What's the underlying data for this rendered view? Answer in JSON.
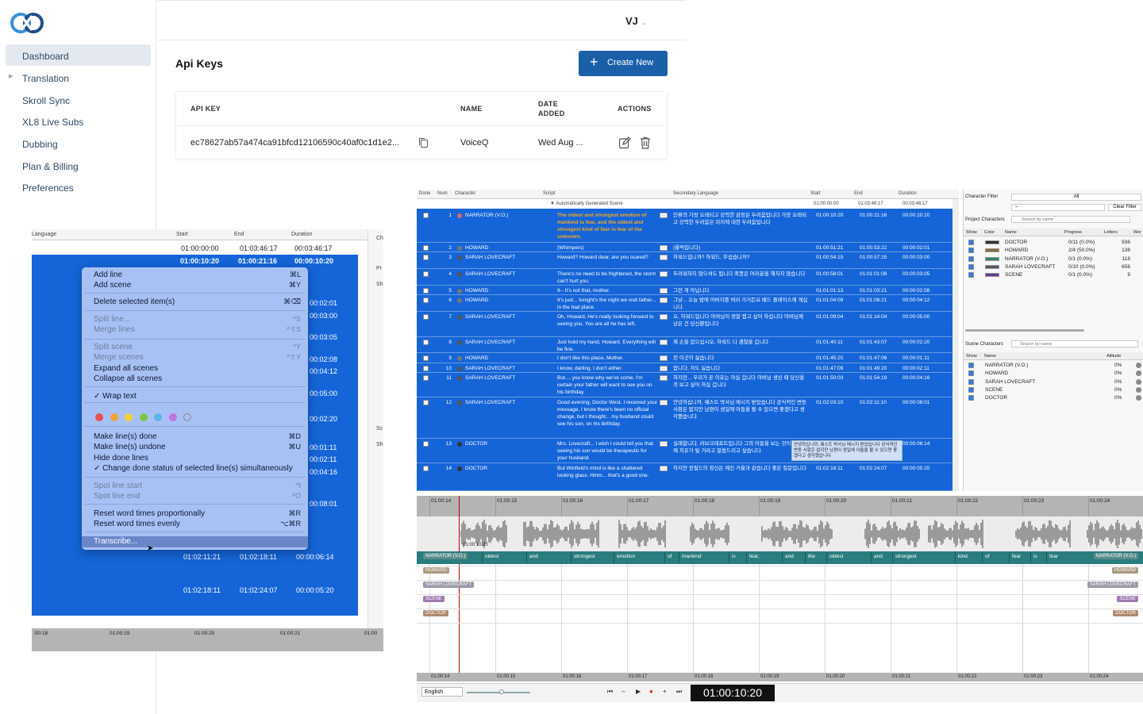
{
  "sidebar": {
    "items": [
      {
        "label": "Dashboard"
      },
      {
        "label": "Translation"
      },
      {
        "label": "Skroll Sync"
      },
      {
        "label": "XL8 Live Subs"
      },
      {
        "label": "Dubbing"
      },
      {
        "label": "Plan & Billing"
      },
      {
        "label": "Preferences"
      }
    ]
  },
  "header": {
    "user_initials": "VJ",
    "user_caret": "⌄"
  },
  "page": {
    "title": "Api Keys",
    "create_button": "Create New",
    "table": {
      "columns": [
        "API KEY",
        "NAME",
        "DATE",
        "ADDED",
        "ACTIONS"
      ],
      "rows": [
        {
          "api_key": "ec78627ab57a474ca91bfcd12106590c40af0c1d1e2...",
          "name": "VoiceQ",
          "date": "Wed Aug ..."
        }
      ]
    }
  },
  "editor_left": {
    "headers": [
      "Language",
      "Start",
      "End",
      "Duration",
      "Ch",
      "Pr",
      "Sh",
      "Sc",
      "Sh"
    ],
    "top_row": [
      "01:00:00:00",
      "01:03:46:17",
      "00:03:46:17"
    ],
    "sel_row": [
      "01:00:10:20",
      "01:00:21:16",
      "00:00:10:20"
    ],
    "durations": [
      "00:02:01",
      "00:03:00",
      "00:03:05",
      "00:02:08",
      "00:04:12",
      "00:05:00",
      "00:02:20",
      "00:01:11",
      "00:02:11",
      "00:04:16",
      "00:08:01"
    ],
    "bottom_rows": [
      [
        "01:02:11:21",
        "01:02:18:11",
        "00:00:06:14"
      ],
      [
        "01:02:18:11",
        "01:02:24:07",
        "00:00:05:20"
      ]
    ],
    "ruler": [
      ":00:18",
      "01:00:19",
      "01:00:20",
      "01:00:21",
      "01:00"
    ],
    "menu": {
      "items": [
        {
          "label": "Add line",
          "shortcut": "⌘L"
        },
        {
          "label": "Add scene",
          "shortcut": "⌘Y"
        },
        {
          "label": "Delete selected item(s)",
          "shortcut": "⌘⌫"
        },
        {
          "label": "Split line...",
          "shortcut": "^S"
        },
        {
          "label": "Merge lines",
          "shortcut": "^⇧S"
        },
        {
          "label": "Split scene",
          "shortcut": "^Y"
        },
        {
          "label": "Merge scenes",
          "shortcut": "^⇧Y"
        },
        {
          "label": "Expand all scenes",
          "shortcut": ""
        },
        {
          "label": "Collapse all scenes",
          "shortcut": ""
        },
        {
          "label": "✓ Wrap text",
          "shortcut": ""
        },
        {
          "label": "Make line(s) done",
          "shortcut": "⌘D"
        },
        {
          "label": "Make line(s) undone",
          "shortcut": "⌘U"
        },
        {
          "label": "Hide done lines",
          "shortcut": ""
        },
        {
          "label": "✓ Change done status of selected line(s) simultaneously",
          "shortcut": ""
        },
        {
          "label": "Spot line start",
          "shortcut": "^I"
        },
        {
          "label": "Spot line end",
          "shortcut": "^O"
        },
        {
          "label": "Reset word times proportionally",
          "shortcut": "⌘R"
        },
        {
          "label": "Reset word times evenly",
          "shortcut": "⌥⌘R"
        },
        {
          "label": "Transcribe...",
          "shortcut": ""
        }
      ],
      "colors": [
        "#e85151",
        "#f2a13c",
        "#f2d23c",
        "#7bc943",
        "#5ab6e8",
        "#c173e0"
      ]
    }
  },
  "editor_right": {
    "headers": [
      "Done",
      "Num",
      "Character",
      "Script",
      "Secondary Language",
      "Start",
      "End",
      "Duration"
    ],
    "scene_label": "▼ Automatically Generated Scene",
    "scene_times": [
      "01:00:00:00",
      "01:03:46:17",
      "00:03:46:17"
    ],
    "rows": [
      {
        "num": "1",
        "char": "NARRATOR (V.O.)",
        "script": "The oldest and strongest emotion of mankind is fear, and the oldest and strongest kind of fear is fear of the unknown.",
        "sec": "인류의 가장 오래되고 강력한 감정은 두려움입니다 가장 오래되고 강력한 두려움은 미지에 대한 두려움입니다",
        "start": "01:00:10:20",
        "end": "01:00:21:16",
        "dur": "00:00:10:20"
      },
      {
        "num": "2",
        "char": "HOWARD",
        "script": "(Whimpers)",
        "sec": "(울먹입니다)",
        "start": "01:00:51:21",
        "end": "01:00:53:22",
        "dur": "00:00:02:01"
      },
      {
        "num": "3",
        "char": "SARAH LOVECRAFT",
        "script": "Howard? Howard dear, are you scared?",
        "sec": "하워드입니까? 하워드, 무섭습니까?",
        "start": "01:00:54:15",
        "end": "01:00:57:15",
        "dur": "00:00:03:00"
      },
      {
        "num": "4",
        "char": "SARAH LOVECRAFT",
        "script": "There's no need to be frightened, the storm can't hurt you.",
        "sec": "두려워하지 않으셔도 됩니다 폭풍은 여러분을 해치지 않습니다",
        "start": "01:00:58:01",
        "end": "01:01:01:06",
        "dur": "00:00:03:05"
      },
      {
        "num": "5",
        "char": "HOWARD",
        "script": "It-- It's not that, mother.",
        "sec": "그런 게 아닙니다",
        "start": "01:01:01:13",
        "end": "01:01:03:21",
        "dur": "00:00:02:08"
      },
      {
        "num": "6",
        "char": "HOWARD",
        "script": "It's just... tonight's the night we visit father... in the bad place.",
        "sec": "그냥... 오늘 밤에 아버지를 뵈러 가거든요 배드 플레이스에 계십니다",
        "start": "01:01:04:09",
        "end": "01:01:08:21",
        "dur": "00:00:04:12"
      },
      {
        "num": "7",
        "char": "SARAH LOVECRAFT",
        "script": "Oh, Howard. He's really looking forward to seeing you. You are all he has left.",
        "sec": "오, 하워드입니다 아버님이 정말 뵙고 싶어 하십니다 아버님께 남은 건 당신뿐입니다",
        "start": "01:01:09:04",
        "end": "01:01:14:04",
        "dur": "00:00:05:00"
      },
      {
        "num": "8",
        "char": "SARAH LOVECRAFT",
        "script": "Just hold my hand, Howard. Everything will be fine.",
        "sec": "제 손을 잡으십시오, 하워드 다 괜찮을 겁니다",
        "start": "01:01:40:11",
        "end": "01:01:43:07",
        "dur": "00:00:02:20"
      },
      {
        "num": "9",
        "char": "HOWARD",
        "script": "I don't like this place, Mother.",
        "sec": "전 이곳이 싫습니다",
        "start": "01:01:45:20",
        "end": "01:01:47:06",
        "dur": "00:00:01:11"
      },
      {
        "num": "10",
        "char": "SARAH LOVECRAFT",
        "script": "I know, darling. I don't either.",
        "sec": "압니다, 저도 싫습니다",
        "start": "01:01:47:09",
        "end": "01:01:49:20",
        "dur": "00:00:02:11"
      },
      {
        "num": "11",
        "char": "SARAH LOVECRAFT",
        "script": "But.... you know why we've come. I'm certain your father will want to see you on his birthday.",
        "sec": "하지만... 우리가 온 이유는 아실 겁니다 아버님 생신 때 당신을 꼭 보고 싶어 하실 겁니다",
        "start": "01:01:50:03",
        "end": "01:01:54:19",
        "dur": "00:00:04:16"
      },
      {
        "num": "12",
        "char": "SARAH LOVECRAFT",
        "script": "Good evening, Doctor West. I received your message, I know there's been no official change, but I thought... my husband could see his son, on his birthday.",
        "sec": "안녕하십니까, 웨스트 박사님 메시지 받았습니다 공식적인 변동 사항은 없지만 남편이 생일에 아들을 볼 수 있으면 좋겠다고 생각했습니다",
        "start": "01:02:03:10",
        "end": "01:02:11:10",
        "dur": "00:00:08:01"
      },
      {
        "num": "13",
        "char": "DOCTOR",
        "script": "Mrs. Lovecraft... I wish I could tell you that seeing his son would be therapeutic for your husband.",
        "sec": "실례합니다, 러브크래프트입니다 그의 아들을 보는 것이 남편분께 치유가 될 거라고 말씀드리고 싶습니다",
        "start": "",
        "end": "",
        "dur": "00:00:06:14"
      },
      {
        "num": "14",
        "char": "DOCTOR",
        "script": "But Winfield's mind is like a shattered looking glass. Hmm... that's a good one.",
        "sec": "하지만 윈필드의 정신은 깨진 거울과 같습니다 좋은 질문입니다",
        "start": "01:02:18:11",
        "end": "01:02:24:07",
        "dur": "00:00:05:20"
      }
    ],
    "tooltip": "안녕하십니까, 웨스트 박사님 메시지 받았습니다 공식적인 변동 사항은 없지만 남편이 생일에 아들을 볼 수 있으면 좋겠다고 생각했습니다",
    "right_panel": {
      "character_filter_label": "Character Filter",
      "filter_value": "All",
      "filter_dash": "–",
      "clear_filter": "Clear Filter",
      "project_characters_label": "Project Characters",
      "search_placeholder": "Search by name",
      "columns": [
        "Show",
        "Color",
        "Name",
        "Progress",
        "Letters",
        "Wor"
      ],
      "characters": [
        {
          "name": "DOCTOR",
          "progress": "0/11 (0.0%)",
          "letters": "936",
          "color": "#333333"
        },
        {
          "name": "HOWARD",
          "progress": "2/4 (50.0%)",
          "letters": "138",
          "color": "#8a6a3a"
        },
        {
          "name": "NARRATOR (V.O.)",
          "progress": "0/1 (0.0%)",
          "letters": "118",
          "color": "#2e8a6e"
        },
        {
          "name": "SARAH LOVECRAFT",
          "progress": "0/10 (0.0%)",
          "letters": "656",
          "color": "#555566"
        },
        {
          "name": "SCENE",
          "progress": "0/1 (0.0%)",
          "letters": "9",
          "color": "#6a3a8a"
        }
      ],
      "scene_characters_label": "Scene Characters",
      "scene_columns": [
        "Show",
        "Name",
        "Altitude"
      ],
      "scene_characters": [
        {
          "name": "NARRATOR (V.O.)",
          "alt": "0%"
        },
        {
          "name": "HOWARD",
          "alt": "0%"
        },
        {
          "name": "SARAH LOVECRAFT",
          "alt": "0%"
        },
        {
          "name": "SCENE",
          "alt": "0%"
        },
        {
          "name": "DOCTOR",
          "alt": "0%"
        }
      ]
    },
    "timeline": {
      "ticks": [
        "01:00:14",
        "01:00:15",
        "01:00:16",
        "01:00:17",
        "01:00:18",
        "01:00:19",
        "01:00:20",
        "01:00:21",
        "01:00:22",
        "01:00:23",
        "01:00:24"
      ],
      "playhead_time": "01:00:10:20",
      "tracks": [
        "NARRATOR (V.O.)",
        "HOWARD",
        "SARAH LOVECRAFT",
        "SCENE",
        "DOCTOR"
      ],
      "words": [
        "oldest",
        "and",
        "strongest",
        "emotion",
        "of",
        "mankind",
        "is",
        "fear,",
        "and",
        "the",
        "oldest",
        "and",
        "strongest",
        "kind",
        "of",
        "fear",
        "is",
        "fear"
      ],
      "right_tags": [
        "NARRATOR (V.O.)",
        "HOWARD",
        "SARAH LOVECRAFT",
        "SCENE",
        "DOCTOR"
      ]
    },
    "transport": {
      "language": "English",
      "timecode": "01:00:10:20"
    }
  }
}
